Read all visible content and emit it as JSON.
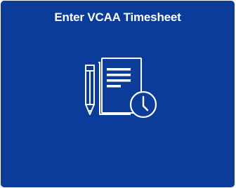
{
  "tile": {
    "title": "Enter VCAA Timesheet",
    "icon": "timesheet-document-pencil-clock-icon",
    "background_color": "#0c3c99",
    "foreground_color": "#ffffff"
  }
}
